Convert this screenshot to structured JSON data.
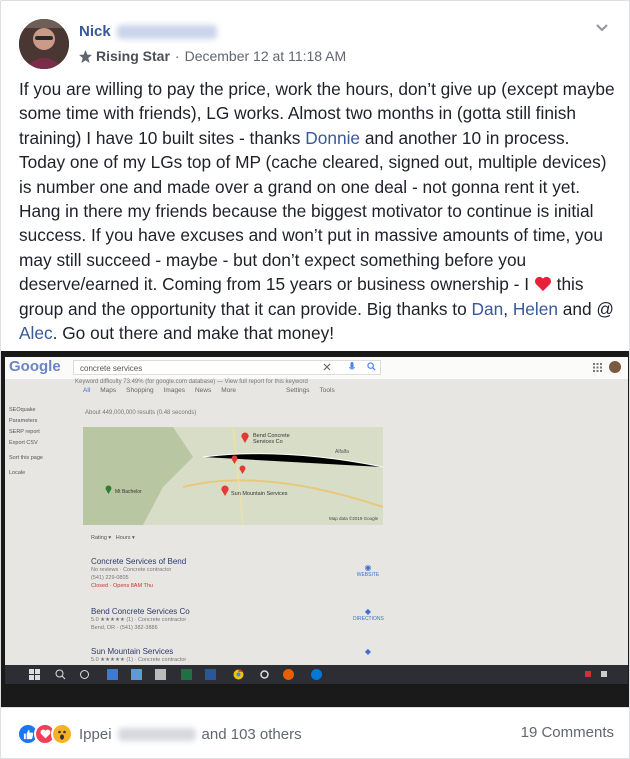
{
  "post": {
    "author_first": "Nick",
    "badge": "Rising Star",
    "separator": "·",
    "timestamp": "December 12 at 11:18 AM",
    "text_parts": [
      "If you are willing to pay the price, work the hours, don’t give up (except maybe some time with friends), LG works. Almost two months in (gotta still finish training) I have 10 built sites - thanks ",
      "Donnie",
      " and another 10 in process. Today one of my LGs top of MP (cache cleared, signed out, multiple devices) is number one and made over a grand on one deal - not gonna rent it yet. Hang in there my friends because the biggest motivator to continue is initial success. If you have excuses and won’t put in massive amounts of time, you may still succeed - maybe - but don’t expect something before you deserve/earned it. Coming from 15 years or business ownership - I ",
      " this group and the opportunity that it can provide. Big thanks to ",
      "Dan",
      ", ",
      "Helen",
      " and @ ",
      "Alec",
      ". Go out there and make that money!"
    ]
  },
  "screenshot": {
    "logo": "Google",
    "query": "concrete services",
    "keyword_line": "Keyword difficulty 73.49% (for google.com database) — View full report for this keyword",
    "tabs": [
      "All",
      "Maps",
      "Shopping",
      "Images",
      "News",
      "More",
      "Settings",
      "Tools"
    ],
    "results_count": "About 449,000,000 results (0.48 seconds)",
    "sidebar": [
      "SEOquake",
      "Parameters",
      "SERP report",
      "Export CSV",
      "Sort this page",
      "Locale"
    ],
    "map_labels": [
      "Bend Concrete Services Co",
      "Alfalfa",
      "Mt Bachelor",
      "Sun Mountain Services",
      "Map data ©2019 Google"
    ],
    "filters": [
      "Rating",
      "Hours"
    ],
    "listings": [
      {
        "name": "Concrete Services of Bend",
        "line1": "No reviews · Concrete contractor",
        "line2": "(541) 229-0805",
        "line3": "Closed · Opens 8AM Thu",
        "action": "WEBSITE"
      },
      {
        "name": "Bend Concrete Services Co",
        "line1": "5.0 ★★★★★ (1) · Concrete contractor",
        "line2": "Bend, OR · (541) 382-3886",
        "line3": "",
        "action": "DIRECTIONS"
      },
      {
        "name": "Sun Mountain Services",
        "line1": "5.0 ★★★★★ (1) · Concrete contractor",
        "line2": "",
        "line3": "",
        "action": ""
      }
    ]
  },
  "footer": {
    "reactor": "Ippei",
    "reaction_suffix": "and 103 others",
    "comments": "19 Comments",
    "reaction_types": [
      "like",
      "love",
      "wow"
    ]
  },
  "colors": {
    "link": "#385898",
    "like": "#1877f2",
    "love": "#f33e58",
    "wow": "#f7b125"
  }
}
